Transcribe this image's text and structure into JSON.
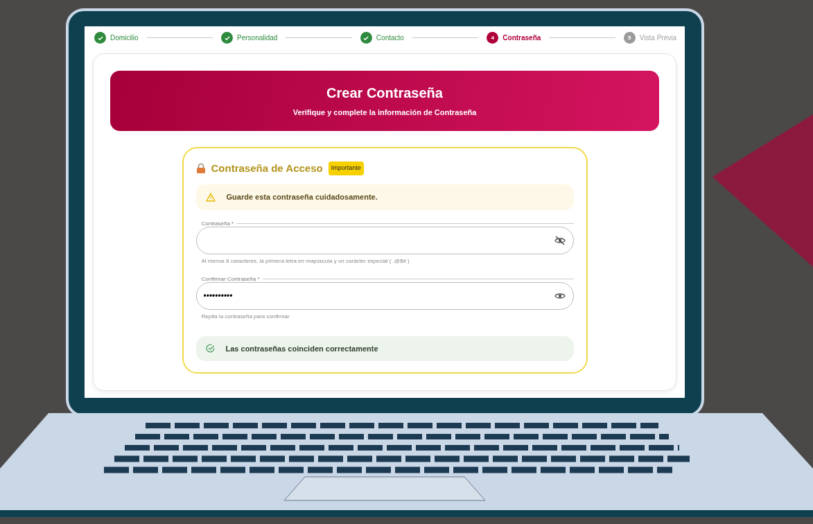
{
  "stepper": [
    {
      "label": "Domicilio",
      "kind": "done"
    },
    {
      "label": "Personalidad",
      "kind": "done"
    },
    {
      "label": "Contacto",
      "kind": "done"
    },
    {
      "label": "Contraseña",
      "kind": "active",
      "number": "4"
    },
    {
      "label": "Vista Previa",
      "kind": "pending",
      "number": "5"
    }
  ],
  "banner": {
    "title": "Crear Contraseña",
    "subtitle": "Verifique y complete la información de Contraseña"
  },
  "section": {
    "title": "Contraseña de Acceso",
    "badge": "Importante",
    "warning": "Guarde esta contraseña cuidadosamente.",
    "fields": [
      {
        "label": "Contraseña *",
        "kind": "hidden",
        "hint": "Al menos 8 caracteres, la primera letra en mayúscula y un carácter especial ( .@$# )"
      },
      {
        "label": "Confirmar Contraseña *",
        "value": "••••••••••",
        "kind": "shown",
        "hint": "Repita la contraseña para confirmar"
      }
    ],
    "success": "Las contraseñas coinciden correctamente"
  }
}
